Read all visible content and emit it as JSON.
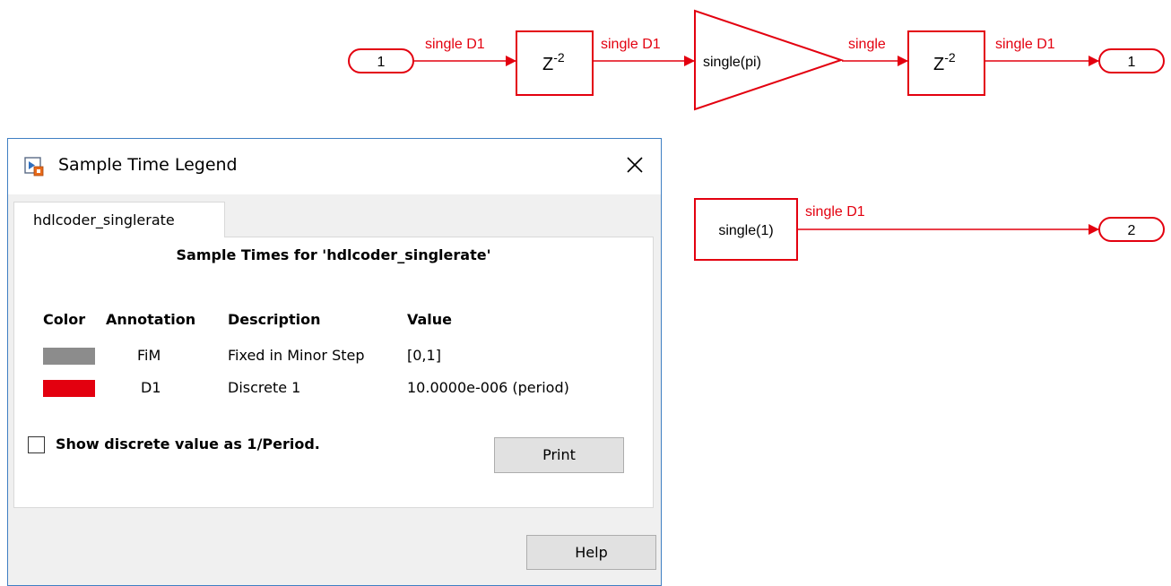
{
  "diagram": {
    "inport1_label": "1",
    "signal1_label": "single D1",
    "delay1_label": "Z",
    "delay1_exp": "-2",
    "signal2_label": "single D1",
    "gain_label": "single(pi)",
    "signal3_label": "single",
    "delay2_label": "Z",
    "delay2_exp": "-2",
    "signal4_label": "single D1",
    "outport1_label": "1",
    "constant_label": "single(1)",
    "signal5_label": "single D1",
    "outport2_label": "2",
    "colors": {
      "block": "#e3000f"
    }
  },
  "dialog": {
    "title": "Sample Time Legend",
    "tab_label": "hdlcoder_singlerate",
    "panel_title": "Sample Times for 'hdlcoder_singlerate'",
    "headers": {
      "color": "Color",
      "annotation": "Annotation",
      "description": "Description",
      "value": "Value"
    },
    "rows": [
      {
        "color": "#8c8c8c",
        "annotation": "FiM",
        "description": "Fixed in Minor Step",
        "value": "[0,1]"
      },
      {
        "color": "#e3000f",
        "annotation": "D1",
        "description": "Discrete 1",
        "value": "10.0000e-006  (period)"
      }
    ],
    "checkbox_label": "Show discrete value as 1/Period.",
    "checkbox_checked": false,
    "print_label": "Print",
    "help_label": "Help"
  }
}
